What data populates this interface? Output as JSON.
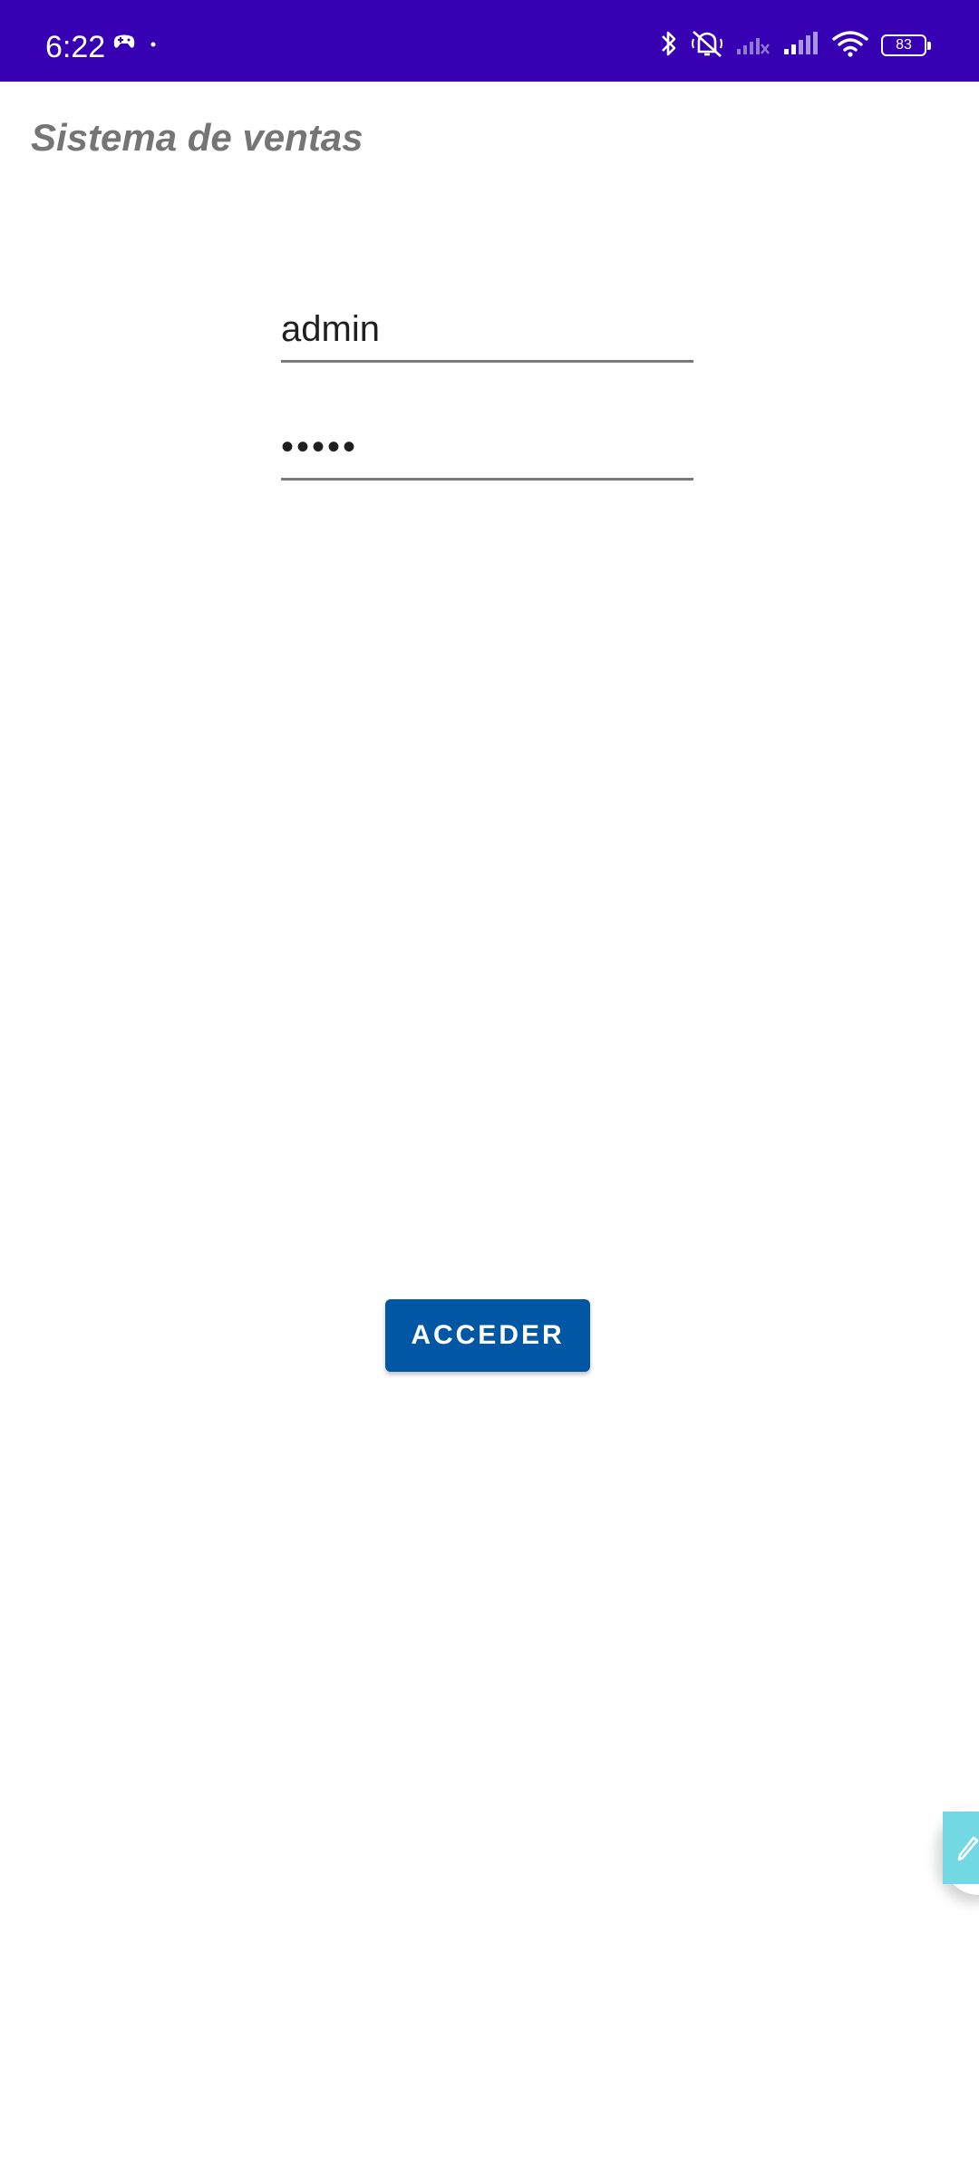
{
  "status_bar": {
    "time": "6:22",
    "battery": "83",
    "background": "#3700b3",
    "icons": [
      "gamepad-icon",
      "dot-icon",
      "bluetooth-icon",
      "vibrate-off-icon",
      "signal-off-icon",
      "signal-icon",
      "wifi-icon",
      "battery-icon"
    ]
  },
  "app": {
    "title": "Sistema de ventas"
  },
  "login": {
    "username_value": "admin",
    "password_value": "admin",
    "button_label": "ACCEDER",
    "button_color": "#0157a3"
  },
  "floating": {
    "icon": "pencil-icon",
    "color": "#72d8e4"
  }
}
